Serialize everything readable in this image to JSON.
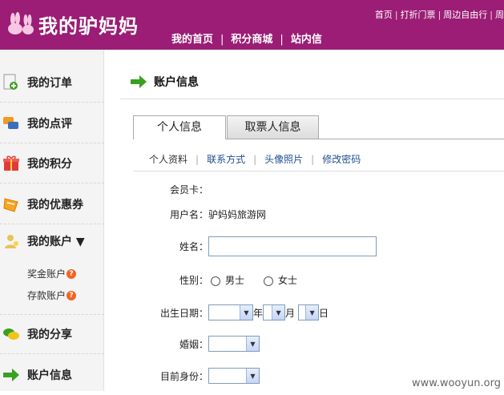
{
  "header": {
    "site_title": "我的驴妈妈",
    "top_links": [
      "首页",
      "打折门票",
      "周边自由行",
      "周"
    ],
    "main_nav": [
      "我的首页",
      "积分商城",
      "站内信"
    ]
  },
  "sidebar": {
    "items": [
      {
        "label": "我的订单",
        "icon": "order-plus-icon"
      },
      {
        "label": "我的点评",
        "icon": "comment-bubbles-icon"
      },
      {
        "label": "我的积分",
        "icon": "gift-icon"
      },
      {
        "label": "我的优惠券",
        "icon": "coupon-icon"
      },
      {
        "label": "我的账户 ▼",
        "icon": "account-person-icon"
      },
      {
        "label": "我的分享",
        "icon": "share-bubbles-icon"
      },
      {
        "label": "账户信息",
        "icon": "green-arrow-icon"
      }
    ],
    "sub_items": [
      "奖金账户",
      "存款账户"
    ]
  },
  "content": {
    "section_title": "账户信息",
    "tabs": [
      "个人信息",
      "取票人信息"
    ],
    "subtabs": [
      "个人资料",
      "联系方式",
      "头像照片",
      "修改密码"
    ],
    "form": {
      "member_card_label": "会员卡：",
      "member_card_value": "",
      "username_label": "用户名：",
      "username_value": "驴妈妈旅游网",
      "name_label": "姓名：",
      "name_value": "",
      "gender_label": "性别：",
      "gender_options": [
        "男士",
        "女士"
      ],
      "birthday_label": "出生日期：",
      "year_unit": "年",
      "month_unit": "月",
      "day_unit": "日",
      "marriage_label": "婚姻：",
      "identity_label": "目前身份："
    }
  },
  "watermark": "www.wooyun.org",
  "colors": {
    "brand": "#9b1d75",
    "link": "#1f4e8f",
    "arrow": "#3aa022"
  }
}
